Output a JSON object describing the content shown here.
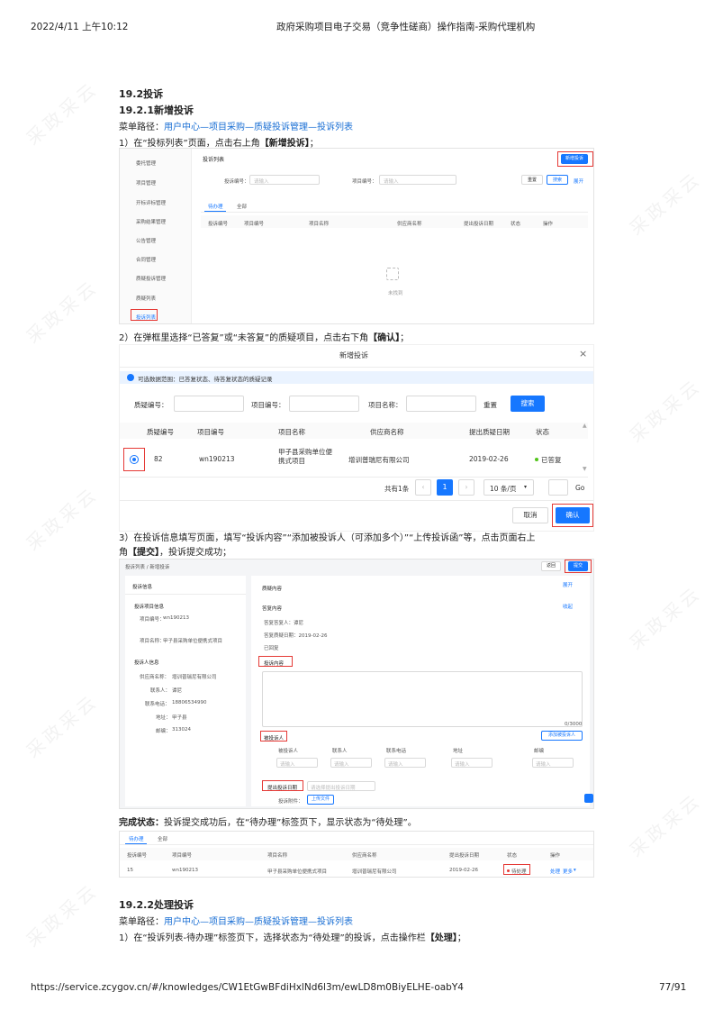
{
  "header": {
    "datetime": "2022/4/11 上午10:12",
    "doc_title": "政府采购项目电子交易（竞争性磋商）操作指南-采购代理机构"
  },
  "footer": {
    "url": "https://service.zcygov.cn/#/knowledges/CW1EtGwBFdiHxlNd6l3m/ewLD8m0BiyELHE-oabY4",
    "page": "77/91"
  },
  "watermark": "采政采云",
  "sec_19_2": "19.2投诉",
  "sec_19_2_1": "19.2.1新增投诉",
  "menu_path_label": "菜单路径：",
  "menu_path_1": "用户中心—项目采购—质疑投诉管理—投诉列表",
  "step1": "1）在“投标列表”页面，点击右上角",
  "step1_bold": "【新增投诉】",
  "step1_end": "；",
  "shot1": {
    "sidebar": [
      "委托管理",
      "项目管理",
      "开标评标管理",
      "采购结果管理",
      "公告管理",
      "合同管理",
      "质疑投诉管理"
    ],
    "sub_items": [
      "质疑列表",
      "投诉列表"
    ],
    "title": "投诉列表",
    "new_btn": "新增投诉",
    "label_code": "投诉编号：",
    "label_proj": "项目编号：",
    "ph": "请输入",
    "reset": "重置",
    "search": "搜索",
    "expand": "展开",
    "tabs": [
      "待办理",
      "全部"
    ],
    "cols": [
      "投诉编号",
      "项目编号",
      "项目名称",
      "供应商名称",
      "提出投诉日期",
      "状态",
      "操作"
    ],
    "empty": "未找到"
  },
  "step2": "2）在弹框里选择“已答复”或“未答复”的质疑项目，点击右下角",
  "step2_bold": "【确认】",
  "step2_end": "；",
  "modal": {
    "title": "新增投诉",
    "close": "×",
    "info": "可选数据范围：已答复状态、待答复状态的质疑记录",
    "f_zy": "质疑编号：",
    "f_xm": "项目编号：",
    "f_mc": "项目名称：",
    "reset": "重置",
    "search": "搜索",
    "cols": [
      "质疑编号",
      "项目编号",
      "项目名称",
      "供应商名称",
      "提出质疑日期",
      "状态"
    ],
    "row": {
      "zy": "82",
      "xm": "wn190213",
      "mc": "甲子县采购单位便携式项目",
      "gys": "增训普瑞尼有限公司",
      "date": "2019-02-26",
      "status": "已答复"
    },
    "total": "共有1条",
    "page": "1",
    "per_page": "10 条/页",
    "go": "Go",
    "cancel": "取消",
    "confirm": "确认"
  },
  "step3_a": "3）在投诉信息填写页面，填写“投诉内容”“添加被投诉人（可添加多个）”“上传投诉函”等，点击页面右上",
  "step3_b": "角",
  "step3_bold": "【提交】",
  "step3_end": "，投诉提交成功；",
  "shot3": {
    "breadcrumb": "投诉列表 / 新增投诉",
    "back": "返回",
    "submit": "提交",
    "left_title": "投诉信息",
    "proj_info": "投诉项目信息",
    "proj_no_label": "项目编号：",
    "proj_no": "wn190213",
    "proj_name_label": "项目名称：",
    "proj_name": "甲子县采购单位便携式项目",
    "person_title": "投诉人信息",
    "sup_label": "供应商名称：",
    "sup": "增训普瑞尼有限公司",
    "contact_label": "联系人：",
    "contact": "谭尼",
    "phone_label": "联系电话：",
    "phone": "18806534990",
    "addr_label": "地址：",
    "addr": "甲子县",
    "zip_label": "邮编：",
    "zip": "313024",
    "zy_content": "质疑内容",
    "expand": "展开",
    "dafu": "答复内容",
    "collapse": "收起",
    "dafu_person": "答复答复人：谭尼",
    "dafu_date": "答复质疑日期：2019-02-26",
    "dafu_status": "已回复",
    "ts_content": "投诉内容",
    "count": "0/3000",
    "btsr": "被投诉人",
    "add_btsr": "添加被投诉人",
    "cols": [
      "被投诉人",
      "联系人",
      "联系电话",
      "地址",
      "邮编"
    ],
    "ph": "请输入",
    "date_label": "提出投诉日期",
    "date_ph": "请选择提出投诉日期",
    "upload_label": "投诉附件：",
    "upload": "上传文件"
  },
  "done_label": "完成状态：",
  "done_text": "投诉提交成功后，在“待办理”标签页下，显示状态为“待处理”。",
  "shot4": {
    "tabs": [
      "待办理",
      "全部"
    ],
    "cols": [
      "投诉编号",
      "项目编号",
      "项目名称",
      "供应商名称",
      "提出投诉日期",
      "状态",
      "操作"
    ],
    "row": {
      "id": "15",
      "xm": "wn190213",
      "mc": "甲子县采购单位便携式项目",
      "gys": "增训普瑞尼有限公司",
      "date": "2019-02-26",
      "status": "待处理",
      "op1": "处理",
      "op2": "更多"
    }
  },
  "sec_19_2_2": "19.2.2处理投诉",
  "menu_path_2": "用户中心—项目采购—质疑投诉管理—投诉列表",
  "step4": "1）在“投诉列表-待办理”标签页下，选择状态为“待处理”的投诉，点击操作栏",
  "step4_bold": "【处理】",
  "step4_end": "；"
}
